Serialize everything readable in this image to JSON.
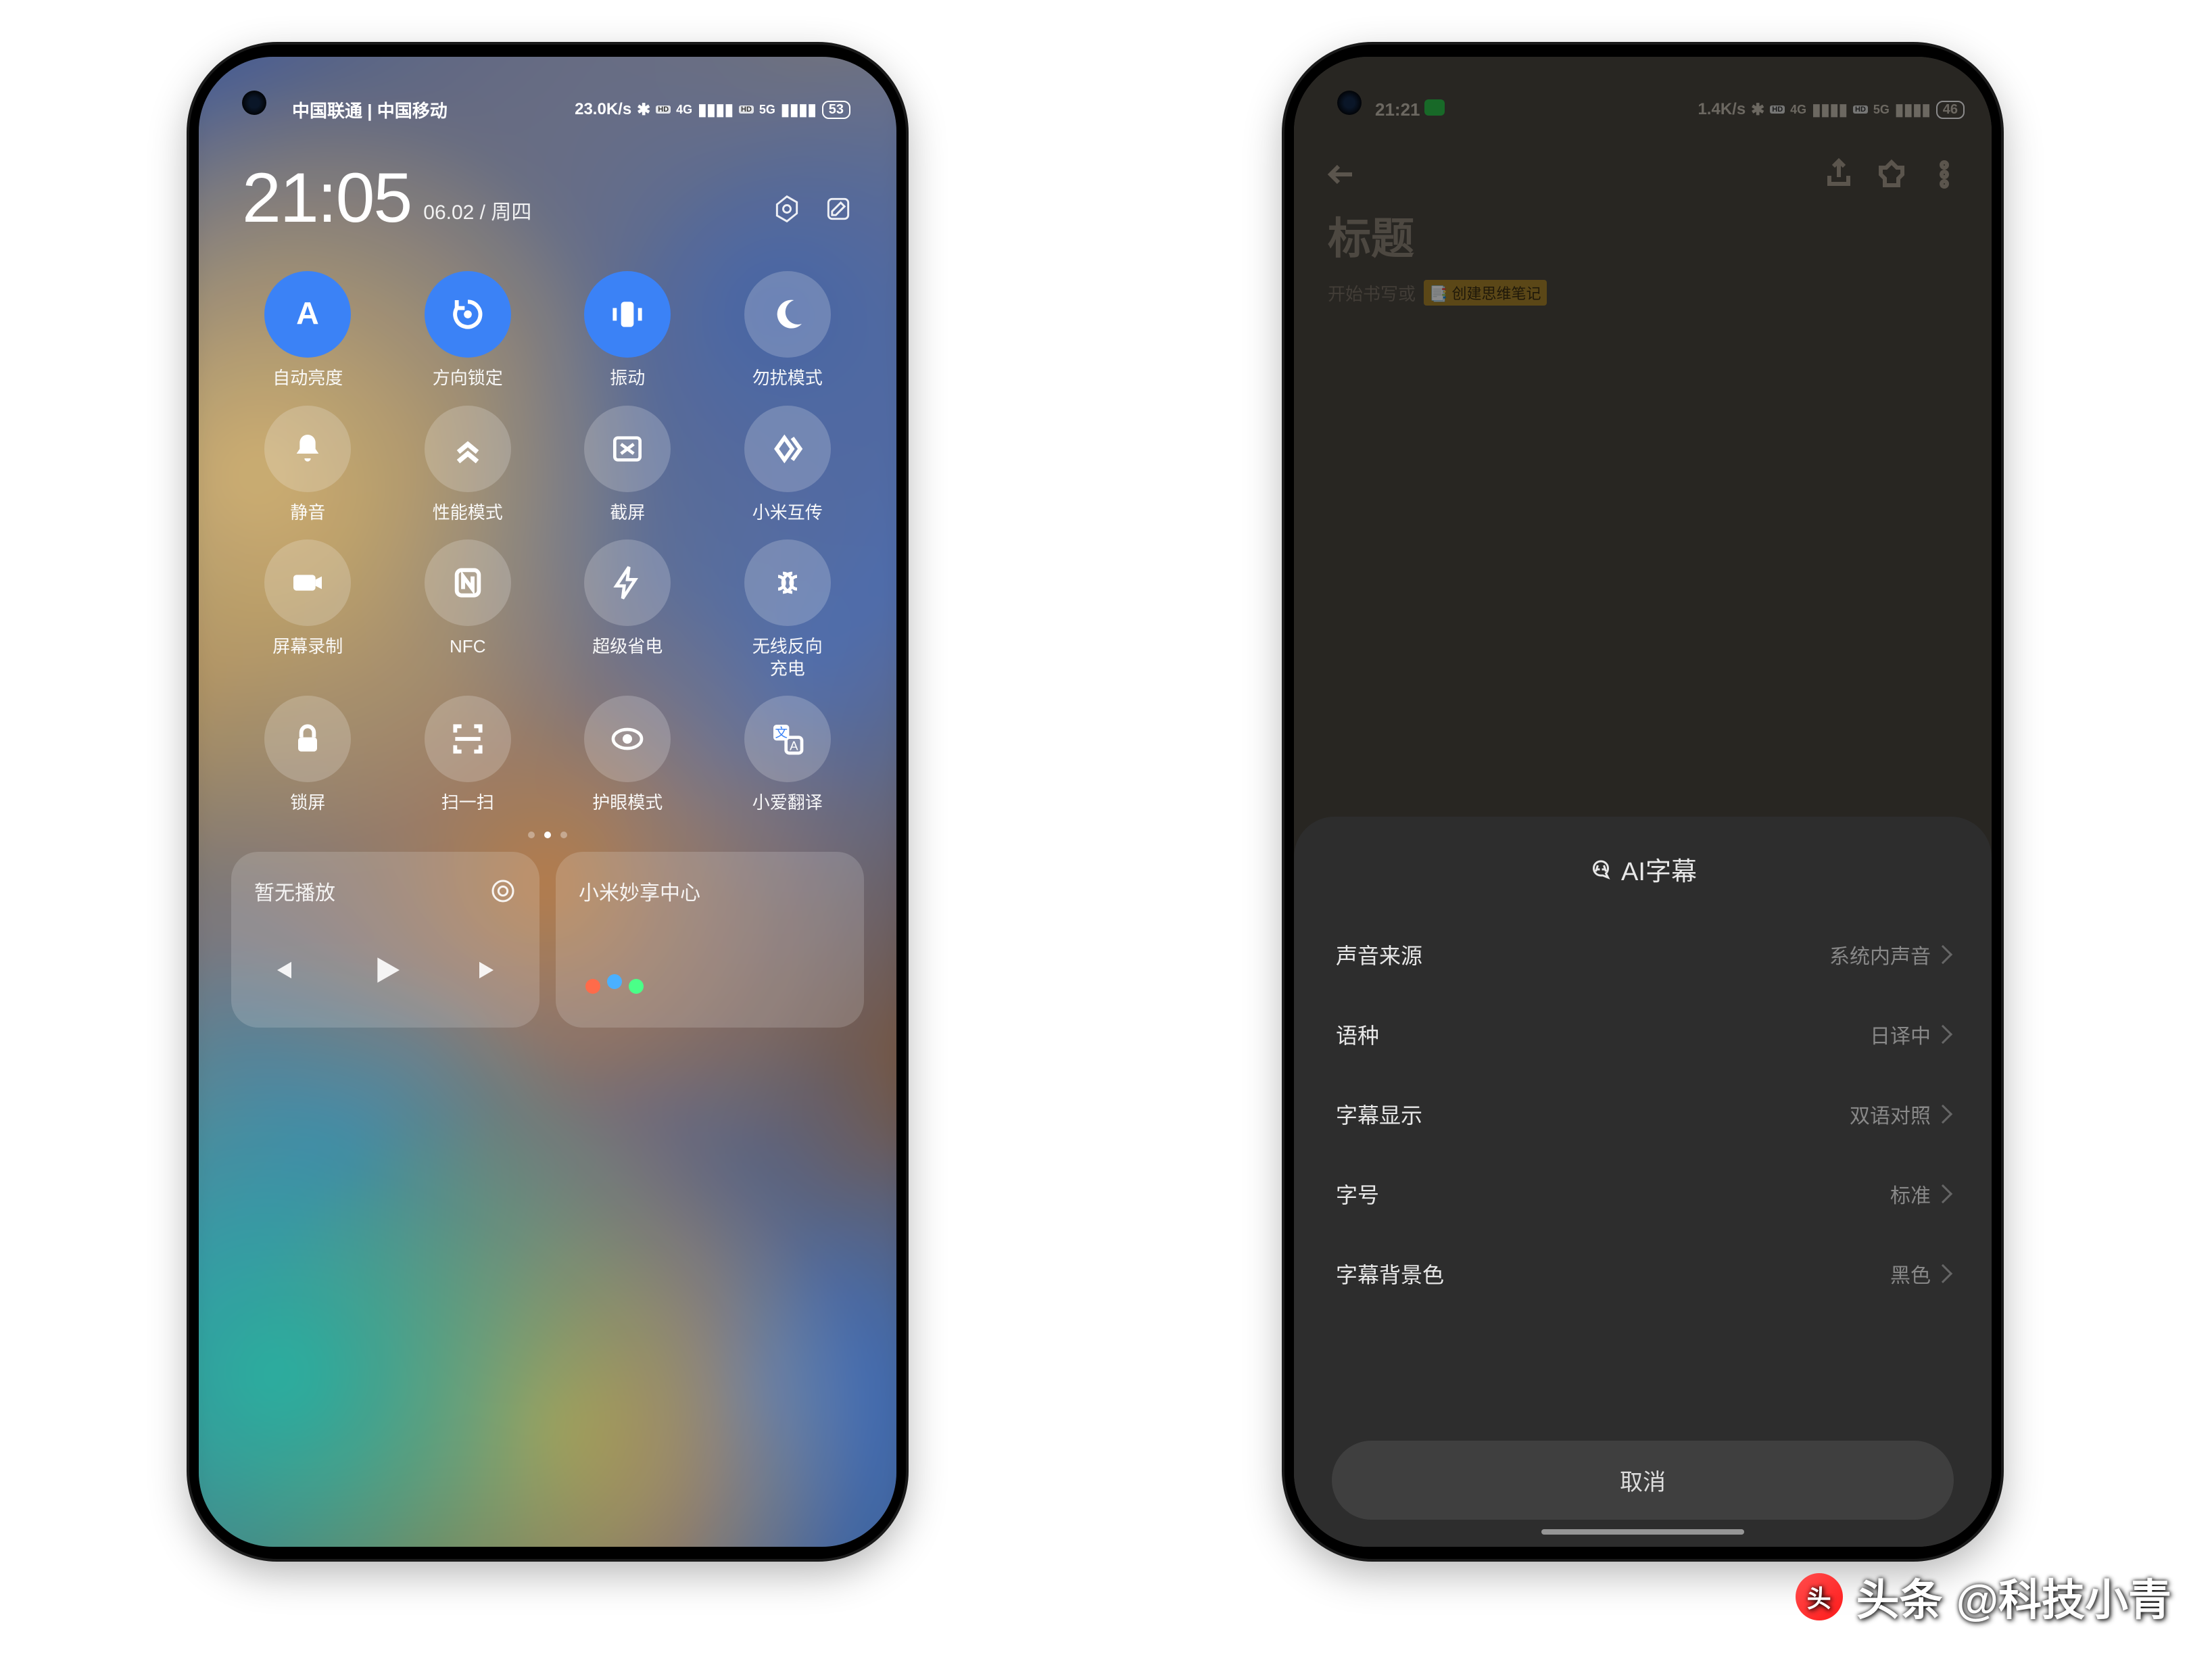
{
  "left": {
    "status": {
      "carrier": "中国联通 | 中国移动",
      "speed": "23.0K/s",
      "battery": "53"
    },
    "clock": {
      "time": "21:05",
      "date": "06.02 / 周四"
    },
    "tiles": [
      {
        "id": "auto-brightness",
        "label": "自动亮度",
        "on": true,
        "icon": "A"
      },
      {
        "id": "rotation-lock",
        "label": "方向锁定",
        "on": true,
        "icon": "rotate"
      },
      {
        "id": "vibrate",
        "label": "振动",
        "on": true,
        "icon": "vibrate"
      },
      {
        "id": "dnd",
        "label": "勿扰模式",
        "on": false,
        "icon": "moon"
      },
      {
        "id": "mute",
        "label": "静音",
        "on": false,
        "icon": "bell"
      },
      {
        "id": "performance",
        "label": "性能模式",
        "on": false,
        "icon": "chevrons"
      },
      {
        "id": "screenshot",
        "label": "截屏",
        "on": false,
        "icon": "scissors"
      },
      {
        "id": "mi-share",
        "label": "小米互传",
        "on": false,
        "icon": "mishare"
      },
      {
        "id": "screen-record",
        "label": "屏幕录制",
        "on": false,
        "icon": "camera"
      },
      {
        "id": "nfc",
        "label": "NFC",
        "on": false,
        "icon": "nfc"
      },
      {
        "id": "battery-saver",
        "label": "超级省电",
        "on": false,
        "icon": "bolt"
      },
      {
        "id": "reverse-charge",
        "label": "无线反向\n充电",
        "on": false,
        "icon": "waves"
      },
      {
        "id": "lock",
        "label": "锁屏",
        "on": false,
        "icon": "lock"
      },
      {
        "id": "scan",
        "label": "扫一扫",
        "on": false,
        "icon": "scan"
      },
      {
        "id": "eye-care",
        "label": "护眼模式",
        "on": false,
        "icon": "eye"
      },
      {
        "id": "xiaoai-translate",
        "label": "小爱翻译",
        "on": false,
        "icon": "translate"
      }
    ],
    "pager": {
      "count": 3,
      "active": 1
    },
    "media": {
      "title": "暂无播放"
    },
    "mi_share_center": {
      "title": "小米妙享中心"
    }
  },
  "right": {
    "status": {
      "time": "21:21",
      "speed": "1.4K/s",
      "battery": "46"
    },
    "note": {
      "title": "标题",
      "hint": "开始书写或",
      "tag_icon": "📑",
      "tag": "创建思维笔记"
    },
    "sheet": {
      "title": "AI字幕",
      "rows": [
        {
          "id": "audio-source",
          "label": "声音来源",
          "value": "系统内声音"
        },
        {
          "id": "language",
          "label": "语种",
          "value": "日译中"
        },
        {
          "id": "subtitle-mode",
          "label": "字幕显示",
          "value": "双语对照"
        },
        {
          "id": "font-size",
          "label": "字号",
          "value": "标准"
        },
        {
          "id": "bg-color",
          "label": "字幕背景色",
          "value": "黑色"
        }
      ],
      "cancel": "取消"
    }
  },
  "watermark": {
    "prefix": "头条",
    "handle": "@科技小青"
  }
}
